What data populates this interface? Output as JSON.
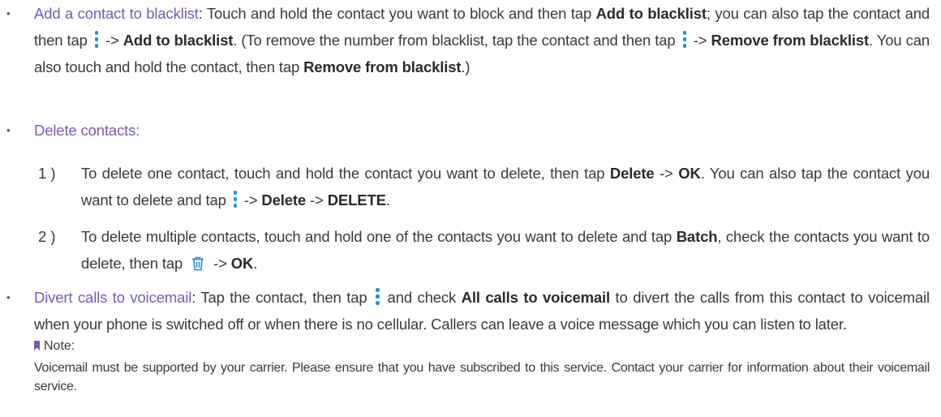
{
  "bullet_glyph": "•",
  "items": {
    "blacklist": {
      "topic": "Add a contact to blacklist",
      "t1": ": Touch and hold the contact you want to block and then tap ",
      "b1": "Add to blacklist",
      "t2": "; you can also tap the contact and then tap ",
      "t3": " -> ",
      "b2": "Add to blacklist",
      "t4": ".  (To remove the number from blacklist, tap the contact and then tap ",
      "t5": " -> ",
      "b3": "Remove from blacklist",
      "t6": ". You can also touch and hold the contact, then tap ",
      "b4": "Remove from blacklist",
      "t7": ".)"
    },
    "delete": {
      "topic": "Delete contacts:",
      "steps": [
        {
          "num": "1 )",
          "t1": "To delete one contact, touch and hold the contact you want to delete, then tap ",
          "b1": "Delete",
          "t2": " -> ",
          "b2": "OK",
          "t3": ". You can also tap the contact you want to delete and tap ",
          "t4": " -> ",
          "b3": "Delete",
          "t5": " -> ",
          "b4": "DELETE",
          "t6": "."
        },
        {
          "num": "2 )",
          "t1": "To delete multiple contacts, touch and hold one of the contacts you want to delete and tap ",
          "b1": "Batch",
          "t2": ", check the contacts you want to delete, then tap ",
          "t3": " -> ",
          "b2": "OK",
          "t4": "."
        }
      ]
    },
    "voicemail": {
      "topic": "Divert calls to voicemail",
      "t1": ": Tap the contact, then tap ",
      "t2": " and check ",
      "b1": "All calls to voicemail",
      "t3": " to divert the calls from this contact to voicemail when your phone is switched off or when there is no cellular. Callers can leave a voice message which you can listen to later.",
      "note_label": "Note:",
      "note_text": "Voicemail must be supported by your carrier. Please ensure that you have subscribed to this service. Contact your carrier for information about their voicemail service."
    }
  },
  "icons": {
    "more": "more-vertical-dots-icon",
    "delete": "trash-icon",
    "note": "bookmark-icon"
  },
  "colors": {
    "topic": "#7a59b8",
    "icon_blue": "#1e8fe5",
    "text": "#3a3a3a"
  }
}
